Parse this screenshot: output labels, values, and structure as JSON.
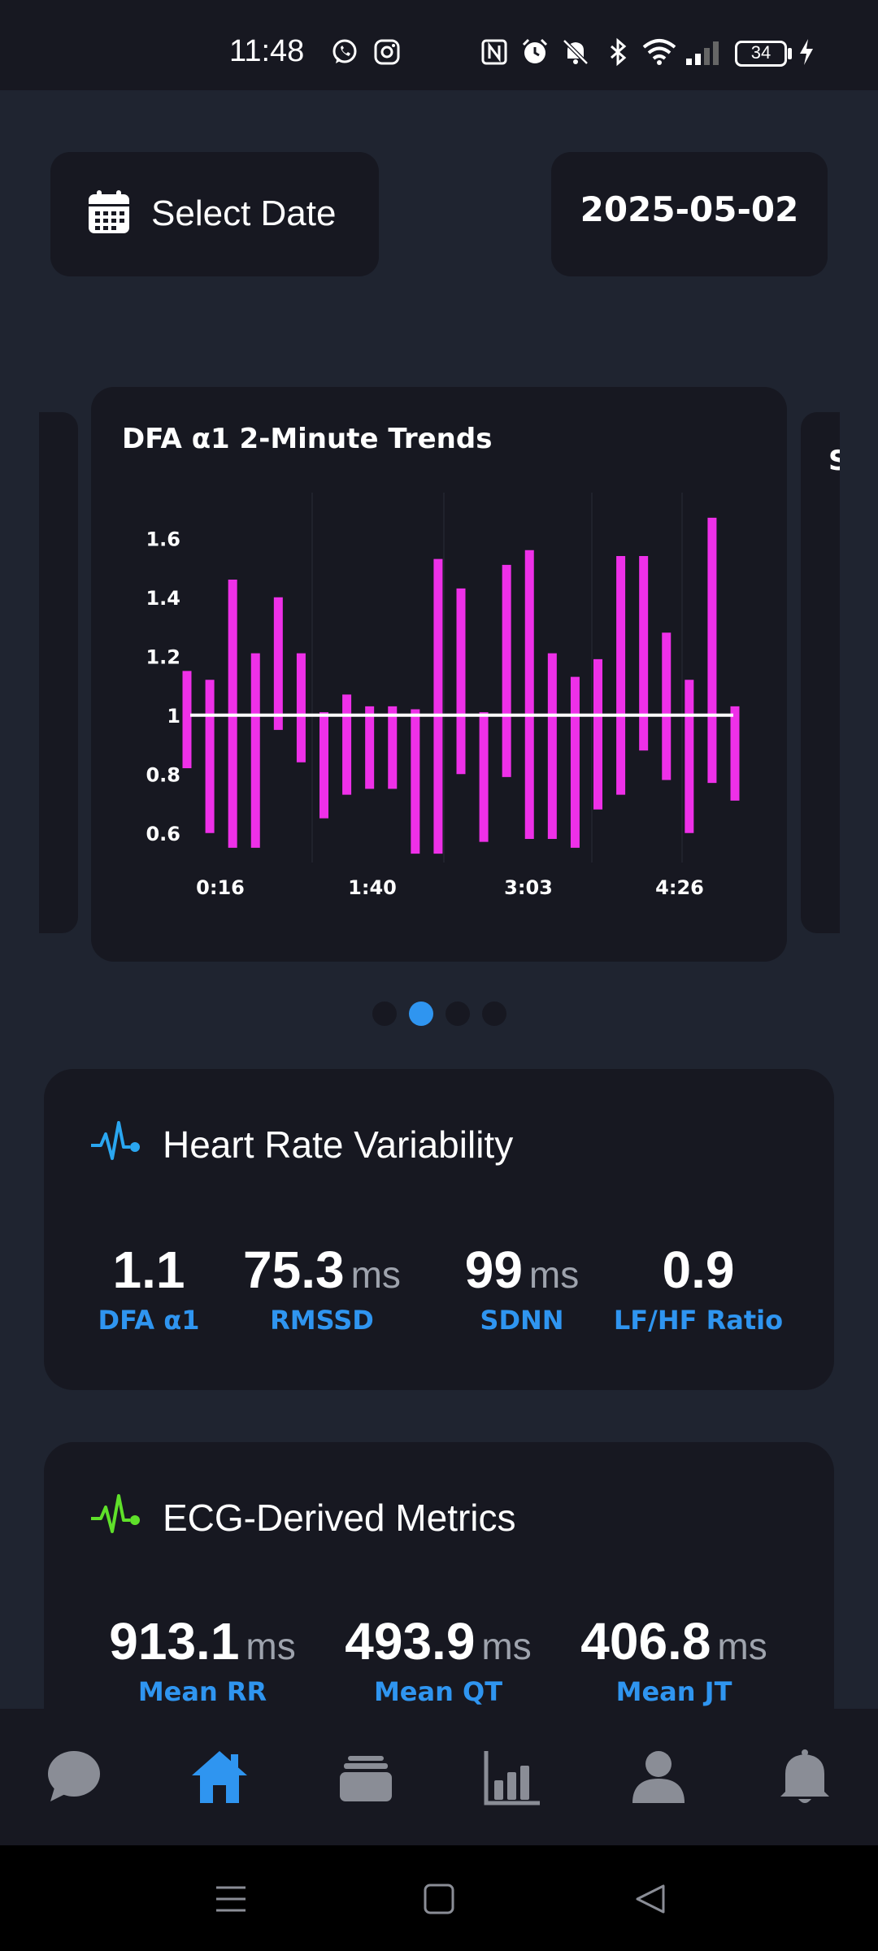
{
  "status_bar": {
    "time": "11:48",
    "battery": "34",
    "icons": [
      "whatsapp-icon",
      "instagram-icon",
      "nfc-icon",
      "alarm-icon",
      "mute-icon",
      "bluetooth-icon",
      "wifi-icon",
      "signal-icon",
      "battery-icon",
      "charging-icon"
    ]
  },
  "header": {
    "select_date_label": "Select Date",
    "date_value": "2025-05-02"
  },
  "carousel": {
    "right_peek_text": "S",
    "active_index": 1,
    "count": 4
  },
  "chart_data": {
    "type": "bar",
    "title": "DFA α1 2-Minute Trends",
    "x_tick_labels": [
      "0:16",
      "1:40",
      "3:03",
      "4:26"
    ],
    "y_tick_labels": [
      "1.6",
      "1.4",
      "1.2",
      "1",
      "0.8",
      "0.6"
    ],
    "ylim": [
      0.5,
      1.7
    ],
    "reference_line": 1.0,
    "bar_color": "#ee30e8",
    "line_color": "#ffffff",
    "bars": [
      {
        "low": 0.82,
        "high": 1.15
      },
      {
        "low": 0.6,
        "high": 1.12
      },
      {
        "low": 0.55,
        "high": 1.46
      },
      {
        "low": 0.55,
        "high": 1.21
      },
      {
        "low": 0.95,
        "high": 1.4
      },
      {
        "low": 0.84,
        "high": 1.21
      },
      {
        "low": 0.65,
        "high": 1.01
      },
      {
        "low": 0.73,
        "high": 1.07
      },
      {
        "low": 0.75,
        "high": 1.03
      },
      {
        "low": 0.75,
        "high": 1.03
      },
      {
        "low": 0.53,
        "high": 1.02
      },
      {
        "low": 0.53,
        "high": 1.53
      },
      {
        "low": 0.8,
        "high": 1.43
      },
      {
        "low": 0.57,
        "high": 1.01
      },
      {
        "low": 0.79,
        "high": 1.51
      },
      {
        "low": 0.58,
        "high": 1.56
      },
      {
        "low": 0.58,
        "high": 1.21
      },
      {
        "low": 0.55,
        "high": 1.13
      },
      {
        "low": 0.68,
        "high": 1.19
      },
      {
        "low": 0.73,
        "high": 1.54
      },
      {
        "low": 0.88,
        "high": 1.54
      },
      {
        "low": 0.78,
        "high": 1.28
      },
      {
        "low": 0.6,
        "high": 1.12
      },
      {
        "low": 0.77,
        "high": 1.67
      },
      {
        "low": 0.71,
        "high": 1.03
      }
    ]
  },
  "hrv_card": {
    "title": "Heart Rate Variability",
    "metrics": [
      {
        "value": "1.1",
        "unit": "",
        "label": "DFA α1"
      },
      {
        "value": "75.3",
        "unit": "ms",
        "label": "RMSSD"
      },
      {
        "value": "99",
        "unit": "ms",
        "label": "SDNN"
      },
      {
        "value": "0.9",
        "unit": "",
        "label": "LF/HF Ratio"
      }
    ],
    "icon_color": "#2aa6f0"
  },
  "ecg_card": {
    "title": "ECG-Derived Metrics",
    "metrics": [
      {
        "value": "913.1",
        "unit": "ms",
        "label": "Mean RR"
      },
      {
        "value": "493.9",
        "unit": "ms",
        "label": "Mean QT"
      },
      {
        "value": "406.8",
        "unit": "ms",
        "label": "Mean JT"
      }
    ],
    "icon_color": "#5fe02a"
  },
  "bottom_nav": {
    "items": [
      "chat-icon",
      "home-icon",
      "cards-icon",
      "stats-icon",
      "profile-icon",
      "notifications-icon"
    ],
    "active": "home-icon",
    "active_color": "#2f95f0",
    "inactive_color": "#8a8d96"
  }
}
